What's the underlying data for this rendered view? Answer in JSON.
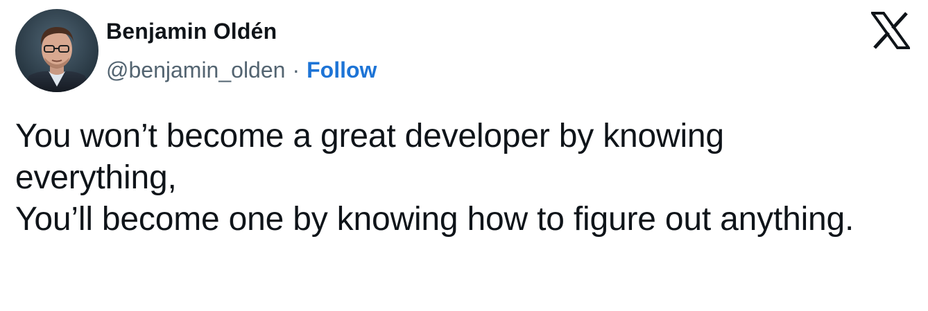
{
  "author": {
    "display_name": "Benjamin Oldén",
    "handle": "@benjamin_olden",
    "separator": "·",
    "follow_label": "Follow",
    "avatar_icon": "profile-photo"
  },
  "platform": {
    "logo_icon": "x-logo-icon"
  },
  "tweet": {
    "lines": [
      "You won’t become a great developer by knowing",
      "everything,",
      "You’ll become one by knowing how to figure out anything."
    ]
  },
  "colors": {
    "text": "#0f1419",
    "secondary_text": "#536471",
    "follow_link": "#1d74d6",
    "background": "#ffffff"
  }
}
